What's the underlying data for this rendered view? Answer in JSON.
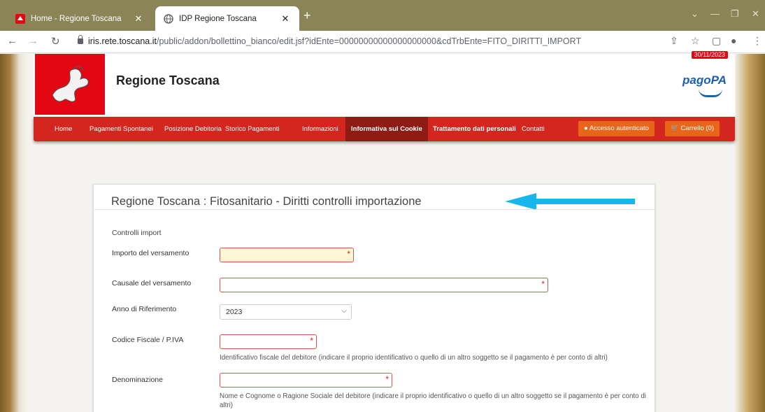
{
  "browser": {
    "tabs": [
      {
        "title": "Home - Regione Toscana",
        "active": false
      },
      {
        "title": "IDP Regione Toscana",
        "active": true
      }
    ],
    "new_tab": "+",
    "url_host": "iris.rete.toscana.it",
    "url_path": "/public/addon/bollettino_bianco/edit.jsf?idEnte=00000000000000000000&cdTrbEnte=FITO_DIRITTI_IMPORT"
  },
  "site": {
    "brand": "Regione Toscana",
    "pagopa": "pagoPA",
    "date_badge": "30/11/2023"
  },
  "menu": {
    "home": "Home",
    "spontanei": "Pagamenti Spontanei",
    "posizione": "Posizione Debitoria",
    "storico": "Storico Pagamenti",
    "informazioni": "Informazioni",
    "cookie": "Informativa sul Cookie",
    "trattamento": "Trattamento dati personali",
    "contatti": "Contatti",
    "accesso": "Accesso autenticato",
    "carrello": "Carrello (0)"
  },
  "form": {
    "title": "Regione Toscana : Fitosanitario - Diritti controlli importazione",
    "section": "Controlli import",
    "importo_label": "Importo del versamento",
    "causale_label": "Causale del versamento",
    "anno_label": "Anno di Riferimento",
    "anno_value": "2023",
    "cf_label": "Codice Fiscale / P.IVA",
    "cf_help": "Identificativo fiscale del debitore (indicare il proprio identificativo o quello di un altro soggetto se il pagamento è per conto di altri)",
    "denominazione_label": "Denominazione",
    "denominazione_help": "Nome e Cognome o Ragione Sociale del debitore (indicare il proprio identificativo o quello di un altro soggetto se il pagamento è per conto di altri)",
    "required_mark": "*"
  },
  "colors": {
    "menu_red": "#d2261e",
    "menu_selected": "#8e1b14",
    "orange_button": "#e8661a",
    "annotation_arrow": "#16b7ec",
    "required_field": "#fcf8d5"
  },
  "icons": {
    "lock": "lock-icon",
    "user": "user-icon",
    "cart": "cart-icon",
    "star": "star-icon"
  }
}
